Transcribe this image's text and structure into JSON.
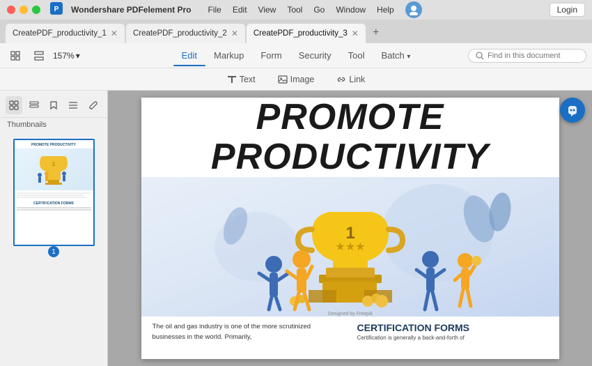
{
  "titleBar": {
    "appName": "Wondershare PDFelement Pro",
    "menu": [
      "File",
      "Edit",
      "View",
      "Tool",
      "Go",
      "Window",
      "Help"
    ],
    "loginLabel": "Login"
  },
  "tabs": [
    {
      "id": "tab1",
      "label": "CreatePDF_productivity_1",
      "active": false
    },
    {
      "id": "tab2",
      "label": "CreatePDF_productivity_2",
      "active": false
    },
    {
      "id": "tab3",
      "label": "CreatePDF_productivity_3",
      "active": true
    }
  ],
  "toolbar": {
    "zoom": "157%",
    "navItems": [
      {
        "id": "edit",
        "label": "Edit",
        "active": true
      },
      {
        "id": "markup",
        "label": "Markup",
        "active": false
      },
      {
        "id": "form",
        "label": "Form",
        "active": false
      },
      {
        "id": "security",
        "label": "Security",
        "active": false
      },
      {
        "id": "tool",
        "label": "Tool",
        "active": false
      },
      {
        "id": "batch",
        "label": "Batch",
        "active": false,
        "hasArrow": true
      }
    ],
    "searchPlaceholder": "Find in this document"
  },
  "subToolbar": {
    "items": [
      {
        "id": "text",
        "label": "Text",
        "icon": "T",
        "active": false
      },
      {
        "id": "image",
        "label": "Image",
        "icon": "🖼",
        "active": false
      },
      {
        "id": "link",
        "label": "Link",
        "icon": "🔗",
        "active": false
      }
    ]
  },
  "sidebar": {
    "label": "Thumbnails",
    "icons": [
      "grid",
      "layout",
      "bookmark",
      "list",
      "attachment"
    ],
    "pageNum": "1"
  },
  "pdf": {
    "mainTitle": "PROMOTE PRODUCTIVITY",
    "bottomTextLeft": "The oil and gas industry is one of the more scrutinized businesses in the world. Primarily,",
    "certTitle": "CERTIFICATION FORMS",
    "certText": "Certification is generally a back-and-forth of"
  },
  "floatingBtn": {
    "icon": "W"
  }
}
